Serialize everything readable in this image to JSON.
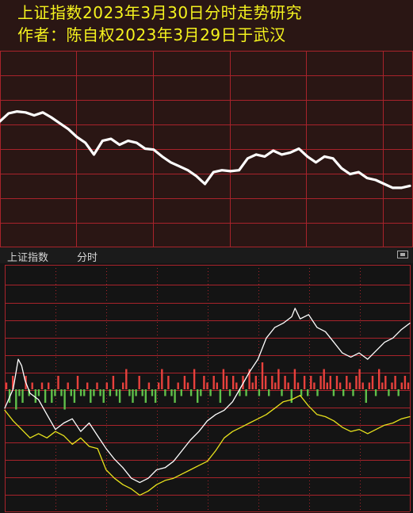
{
  "top": {
    "title": "上证指数2023年3月30日分时走势研究",
    "subtitle": "作者：陈自权2023年3月29日于武汉"
  },
  "bottom": {
    "header_index": "上证指数",
    "header_mode": "分时"
  },
  "colors": {
    "top_background": "#2a1614",
    "top_grid": "#a8232b",
    "bottom_background": "#141414",
    "bottom_grid": "#a8232b",
    "title_text": "#f5f31e",
    "index_line": "#ffffff",
    "average_line": "#e8e21c",
    "volume_up": "#e8413c",
    "volume_down": "#5fbf4a"
  },
  "chart_data": [
    {
      "type": "line",
      "title": "上证指数2023年3月30日分时走势研究",
      "subtitle": "作者：陈自权2023年3月29日于武汉",
      "x_range": [
        0,
        240
      ],
      "ylim": [
        0,
        10
      ],
      "grid": true,
      "series": [
        {
          "x": [
            0,
            5,
            10,
            15,
            20,
            25,
            30,
            35,
            40,
            45,
            50,
            55,
            60,
            65,
            70,
            75,
            80,
            85,
            90,
            95,
            100,
            105,
            110,
            115,
            120,
            125,
            130,
            135,
            140,
            145,
            150,
            155,
            160,
            165,
            170,
            175,
            180,
            185,
            190,
            195,
            200,
            205,
            210,
            215,
            220,
            225,
            230,
            235,
            240
          ],
          "values": [
            6.4,
            6.8,
            6.9,
            6.85,
            6.7,
            6.85,
            6.6,
            6.3,
            6.0,
            5.6,
            5.3,
            4.7,
            5.4,
            5.5,
            5.2,
            5.4,
            5.3,
            5.0,
            4.95,
            4.6,
            4.3,
            4.1,
            3.9,
            3.6,
            3.2,
            3.8,
            3.9,
            3.85,
            3.9,
            4.5,
            4.7,
            4.6,
            4.9,
            4.7,
            4.8,
            5.0,
            4.6,
            4.3,
            4.6,
            4.5,
            4.0,
            3.7,
            3.8,
            3.5,
            3.4,
            3.2,
            3.0,
            3.0,
            3.1
          ]
        }
      ]
    },
    {
      "type": "line",
      "x_range": [
        0,
        240
      ],
      "ylim": [
        0,
        10
      ],
      "grid": true,
      "series": [
        {
          "x": [
            0,
            5,
            8,
            10,
            12,
            15,
            20,
            25,
            30,
            35,
            40,
            45,
            50,
            55,
            60,
            65,
            70,
            75,
            80,
            85,
            90,
            95,
            100,
            105,
            110,
            115,
            120,
            125,
            130,
            135,
            140,
            145,
            150,
            155,
            160,
            165,
            170,
            172,
            175,
            180,
            185,
            190,
            195,
            200,
            205,
            210,
            215,
            220,
            225,
            230,
            235,
            240
          ],
          "values": [
            4.3,
            5.2,
            6.6,
            6.3,
            5.6,
            5.0,
            4.7,
            4.0,
            3.3,
            3.6,
            3.8,
            3.2,
            3.6,
            3.0,
            2.4,
            1.9,
            1.5,
            1.0,
            0.8,
            1.0,
            1.4,
            1.5,
            1.8,
            2.3,
            2.8,
            3.2,
            3.7,
            4.0,
            4.2,
            4.6,
            5.3,
            6.0,
            6.6,
            7.6,
            8.1,
            8.3,
            8.6,
            9.0,
            8.5,
            8.7,
            8.1,
            7.9,
            7.4,
            6.9,
            6.7,
            6.9,
            6.6,
            7.0,
            7.4,
            7.6,
            8.0,
            8.3
          ]
        },
        {
          "x": [
            0,
            5,
            10,
            15,
            20,
            25,
            30,
            35,
            40,
            45,
            50,
            55,
            60,
            65,
            70,
            75,
            80,
            85,
            90,
            95,
            100,
            105,
            110,
            115,
            120,
            125,
            130,
            135,
            140,
            145,
            150,
            155,
            160,
            165,
            170,
            175,
            180,
            185,
            190,
            195,
            200,
            205,
            210,
            215,
            220,
            225,
            230,
            235,
            240
          ],
          "values": [
            4.2,
            3.7,
            3.3,
            2.9,
            3.1,
            2.9,
            3.2,
            3.0,
            2.6,
            2.9,
            2.5,
            2.4,
            1.4,
            1.0,
            0.7,
            0.5,
            0.2,
            0.4,
            0.7,
            0.9,
            1.0,
            1.2,
            1.4,
            1.6,
            1.8,
            2.3,
            2.9,
            3.2,
            3.4,
            3.6,
            3.8,
            4.0,
            4.3,
            4.6,
            4.7,
            4.9,
            4.4,
            4.0,
            3.9,
            3.7,
            3.4,
            3.2,
            3.3,
            3.1,
            3.3,
            3.5,
            3.6,
            3.8,
            3.9
          ]
        }
      ]
    },
    {
      "type": "bar",
      "x_range": [
        0,
        240
      ],
      "values": [
        1,
        -2,
        2,
        -3,
        -1,
        -2,
        2,
        -1,
        1,
        -2,
        -1,
        1,
        -2,
        1,
        -2,
        -1,
        2,
        -1,
        -3,
        1,
        -1,
        -2,
        2,
        -1,
        -1,
        1,
        -2,
        -1,
        1,
        -1,
        -2,
        1,
        -1,
        2,
        -1,
        -2,
        1,
        3,
        -1,
        -2,
        -1,
        2,
        -1,
        -2,
        1,
        -1,
        -2,
        1,
        3,
        -1,
        2,
        -1,
        -2,
        1,
        -1,
        2,
        1,
        -1,
        3,
        -2,
        -1,
        2,
        1,
        -1,
        2,
        1,
        -2,
        3,
        2,
        -1,
        2,
        1,
        -1,
        2,
        -1,
        3,
        1,
        2,
        -1,
        4,
        2,
        -1,
        2,
        1,
        3,
        -1,
        2,
        1,
        -2,
        3,
        1,
        -1,
        2,
        -1,
        2,
        1,
        -1,
        2,
        3,
        1,
        2,
        -1,
        2,
        1,
        -1,
        2,
        1,
        -1,
        2,
        3,
        1,
        -2,
        1,
        2,
        -1,
        3,
        1,
        2,
        -1,
        1,
        2,
        -1,
        1,
        2,
        1
      ]
    }
  ]
}
